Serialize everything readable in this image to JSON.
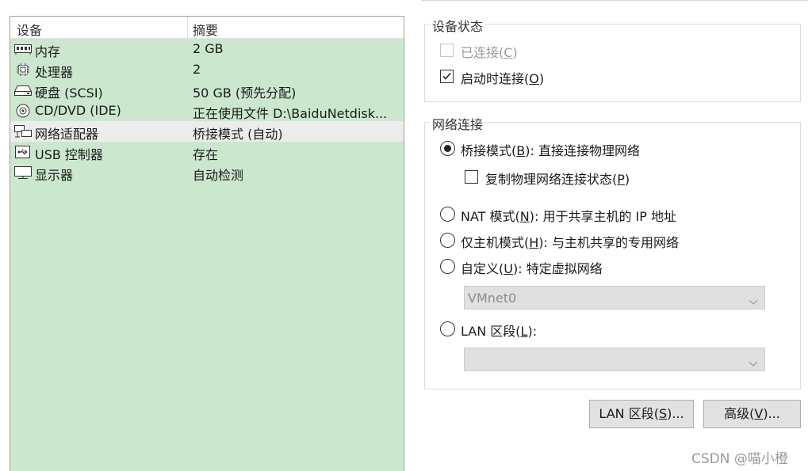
{
  "device_list": {
    "headers": [
      "设备",
      "摘要"
    ],
    "rows": [
      {
        "icon": "memory-icon",
        "name": "内存",
        "summary": "2 GB"
      },
      {
        "icon": "processor-icon",
        "name": "处理器",
        "summary": "2"
      },
      {
        "icon": "hard-disk-icon",
        "name": "硬盘 (SCSI)",
        "summary": "50 GB (预先分配)"
      },
      {
        "icon": "cd-dvd-icon",
        "name": "CD/DVD (IDE)",
        "summary": "正在使用文件 D:\\BaiduNetdisk..."
      },
      {
        "icon": "network-adapter-icon",
        "name": "网络适配器",
        "summary": "桥接模式 (自动)",
        "selected": true
      },
      {
        "icon": "usb-icon",
        "name": "USB 控制器",
        "summary": "存在"
      },
      {
        "icon": "display-icon",
        "name": "显示器",
        "summary": "自动检测"
      }
    ]
  },
  "device_status": {
    "title": "设备状态",
    "connected": {
      "text": "已连接(",
      "key": "C",
      "end": ")",
      "checked": false,
      "disabled": true
    },
    "connect_at_power_on": {
      "text": "启动时连接(",
      "key": "O",
      "end": ")",
      "checked": true,
      "disabled": false
    }
  },
  "network_connection": {
    "title": "网络连接",
    "bridged": {
      "text": "桥接模式(",
      "key": "B",
      "end": "): 直接连接物理网络",
      "selected": true
    },
    "replicate": {
      "text": "复制物理网络连接状态(",
      "key": "P",
      "end": ")",
      "checked": false
    },
    "nat": {
      "text": "NAT 模式(",
      "key": "N",
      "end": "): 用于共享主机的 IP 地址",
      "selected": false
    },
    "host_only": {
      "text": "仅主机模式(",
      "key": "H",
      "end": "): 与主机共享的专用网络",
      "selected": false
    },
    "custom": {
      "text": "自定义(",
      "key": "U",
      "end": "): 特定虚拟网络",
      "selected": false
    },
    "custom_select_value": "VMnet0",
    "lan_segment": {
      "text": "LAN 区段(",
      "key": "L",
      "end": "):",
      "selected": false
    },
    "lan_segment_select_value": ""
  },
  "buttons": {
    "lan_segments": {
      "text": "LAN 区段(",
      "key": "S",
      "end": ")..."
    },
    "advanced": {
      "text": "高级(",
      "key": "V",
      "end": ")..."
    }
  },
  "watermark": "CSDN @喵小橙"
}
